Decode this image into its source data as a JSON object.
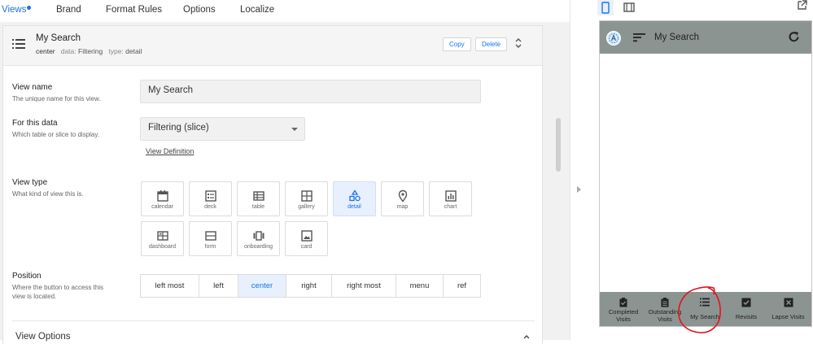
{
  "tabs": [
    {
      "label": "Views",
      "active": true
    },
    {
      "label": "Brand"
    },
    {
      "label": "Format Rules"
    },
    {
      "label": "Options"
    },
    {
      "label": "Localize"
    }
  ],
  "view": {
    "title": "My Search",
    "position": "center",
    "data_label": "data:",
    "data_value": "Filtering",
    "type_label": "type:",
    "type_value": "detail",
    "copy_label": "Copy",
    "delete_label": "Delete"
  },
  "fields": {
    "view_name": {
      "label": "View name",
      "desc": "The unique name for this view.",
      "value": "My Search"
    },
    "for_data": {
      "label": "For this data",
      "desc": "Which table or slice to display.",
      "value": "Filtering (slice)",
      "link": "View Definition"
    },
    "view_type": {
      "label": "View type",
      "desc": "What kind of view this is."
    },
    "position": {
      "label": "Position",
      "desc1": "Where the button to access this",
      "desc2": "view is located."
    }
  },
  "view_types": [
    "calendar",
    "deck",
    "table",
    "gallery",
    "detail",
    "map",
    "chart",
    "dashboard",
    "form",
    "onboarding",
    "card"
  ],
  "selected_view_type": "detail",
  "positions": [
    "left most",
    "left",
    "center",
    "right",
    "right most",
    "menu",
    "ref"
  ],
  "selected_position": "center",
  "view_options_label": "View Options",
  "preview": {
    "title": "My Search",
    "nav": [
      {
        "line1": "Completed",
        "line2": "Visits",
        "icon": "clipboard-check-icon"
      },
      {
        "line1": "Outstanding",
        "line2": "Visits",
        "icon": "clipboard-list-icon"
      },
      {
        "line1": "My Search",
        "line2": "",
        "icon": "list-icon"
      },
      {
        "line1": "Revisits",
        "line2": "",
        "icon": "checkbox-icon"
      },
      {
        "line1": "Lapse Visits",
        "line2": "",
        "icon": "x-box-icon"
      }
    ]
  },
  "colors": {
    "accent": "#1a73e8",
    "preview_bar": "#8c9491",
    "selected_bg": "#e8f0fe",
    "annotation_red": "#e0141e"
  }
}
